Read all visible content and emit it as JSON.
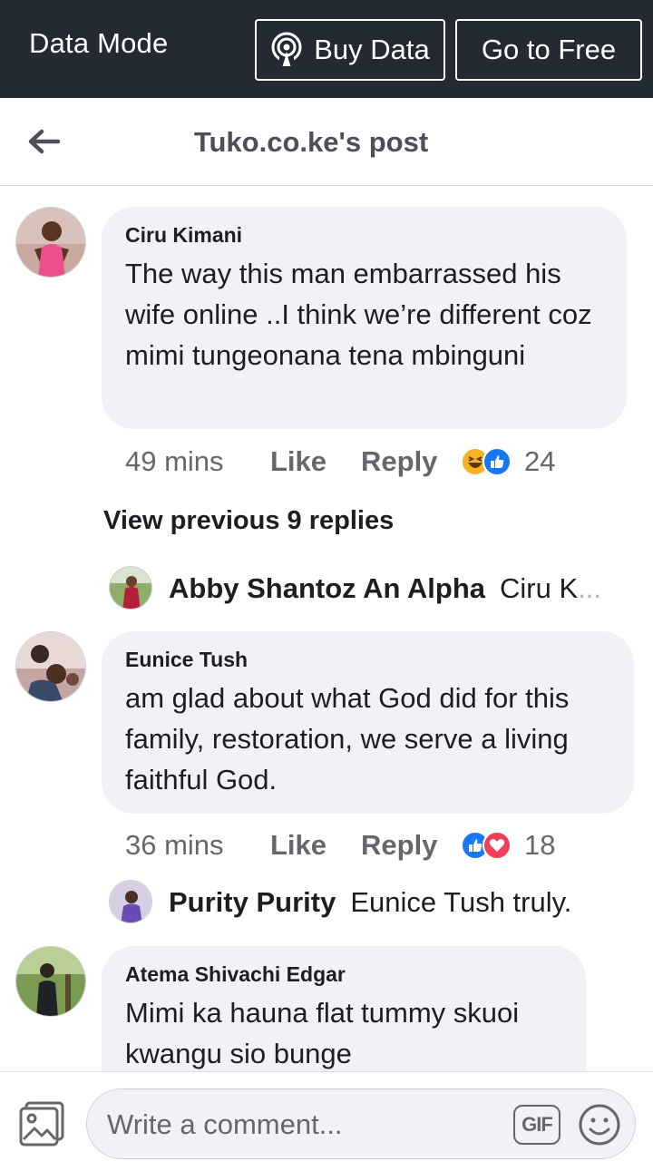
{
  "databar": {
    "mode_label": "Data Mode",
    "buy_label": "Buy Data",
    "free_label": "Go to Free"
  },
  "header": {
    "title": "Tuko.co.ke's post"
  },
  "comments": [
    {
      "name": "Ciru Kimani",
      "text": "The way this man embarrassed his wife online ..I think we’re different coz mimi tungeonana tena mbinguni",
      "time": "49 mins",
      "like": "Like",
      "reply": "Reply",
      "reactions": [
        "haha",
        "like"
      ],
      "count": "24"
    },
    {
      "name": "Eunice Tush",
      "text": "am glad about what God did for this family, restoration, we serve a living faithful God.",
      "time": "36 mins",
      "like": "Like",
      "reply": "Reply",
      "reactions": [
        "like",
        "love"
      ],
      "count": "18"
    },
    {
      "name": "Atema Shivachi Edgar",
      "text": "Mimi ka hauna flat tummy skuoi kwangu sio bunge"
    }
  ],
  "view_previous": "View previous 9 replies",
  "replies": [
    {
      "name": "Abby Shantoz An Alpha",
      "text": "Ciru K",
      "ellipsis": "..."
    },
    {
      "name": "Purity Purity",
      "text": "Eunice Tush truly."
    }
  ],
  "composer": {
    "placeholder": "Write a comment...",
    "gif_label": "GIF"
  },
  "colors": {
    "databar_bg": "#232a33",
    "bubble_bg": "#f0f2f5",
    "like_blue": "#1877f2",
    "love_red": "#f33e58",
    "haha_yellow": "#f7b125"
  },
  "icons": [
    "back-arrow-icon",
    "broadcast-icon",
    "photo-icon",
    "emoji-icon",
    "haha-reaction-icon",
    "like-reaction-icon",
    "love-reaction-icon"
  ]
}
